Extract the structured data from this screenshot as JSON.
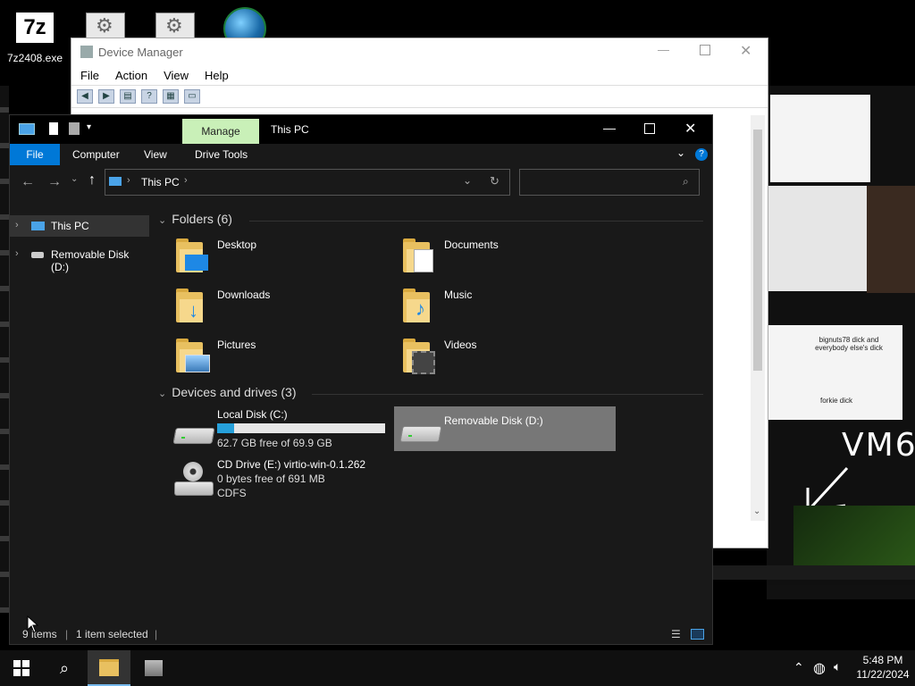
{
  "desktop": {
    "icons": [
      {
        "label": "7z2408.exe"
      }
    ]
  },
  "background": {
    "doodle_text_1": "bignuts78 dick and everybody else's dick",
    "doodle_text_2": "forkie dick",
    "scrawl": "VM6"
  },
  "device_manager": {
    "title": "Device Manager",
    "menu": [
      "File",
      "Action",
      "View",
      "Help"
    ]
  },
  "explorer": {
    "title": "This PC",
    "manage_tab": "Manage",
    "ribbon_tabs": [
      "File",
      "Computer",
      "View",
      "Drive Tools"
    ],
    "address": {
      "crumb": "This PC"
    },
    "search_placeholder": "",
    "nav": [
      {
        "label": "This PC"
      },
      {
        "label": "Removable Disk (D:)"
      }
    ],
    "folders_header": "Folders (6)",
    "folders": [
      {
        "name": "Desktop"
      },
      {
        "name": "Documents"
      },
      {
        "name": "Downloads"
      },
      {
        "name": "Music"
      },
      {
        "name": "Pictures"
      },
      {
        "name": "Videos"
      }
    ],
    "drives_header": "Devices and drives (3)",
    "drives": [
      {
        "name": "Local Disk (C:)",
        "detail": "62.7 GB free of 69.9 GB",
        "used_fraction": 0.103
      },
      {
        "name": "Removable Disk (D:)",
        "selected": true
      },
      {
        "name": "CD Drive (E:) virtio-win-0.1.262",
        "detail": "0 bytes free of 691 MB",
        "fs": "CDFS"
      }
    ],
    "status": {
      "items": "9 items",
      "selected": "1 item selected"
    }
  },
  "taskbar": {
    "time": "5:48 PM",
    "date": "11/22/2024"
  },
  "colors": {
    "accent": "#0078d7",
    "manage_tab_bg": "#c9f0b8",
    "selected_drive_bg": "#777777",
    "storage_bar": "#26a0da"
  }
}
